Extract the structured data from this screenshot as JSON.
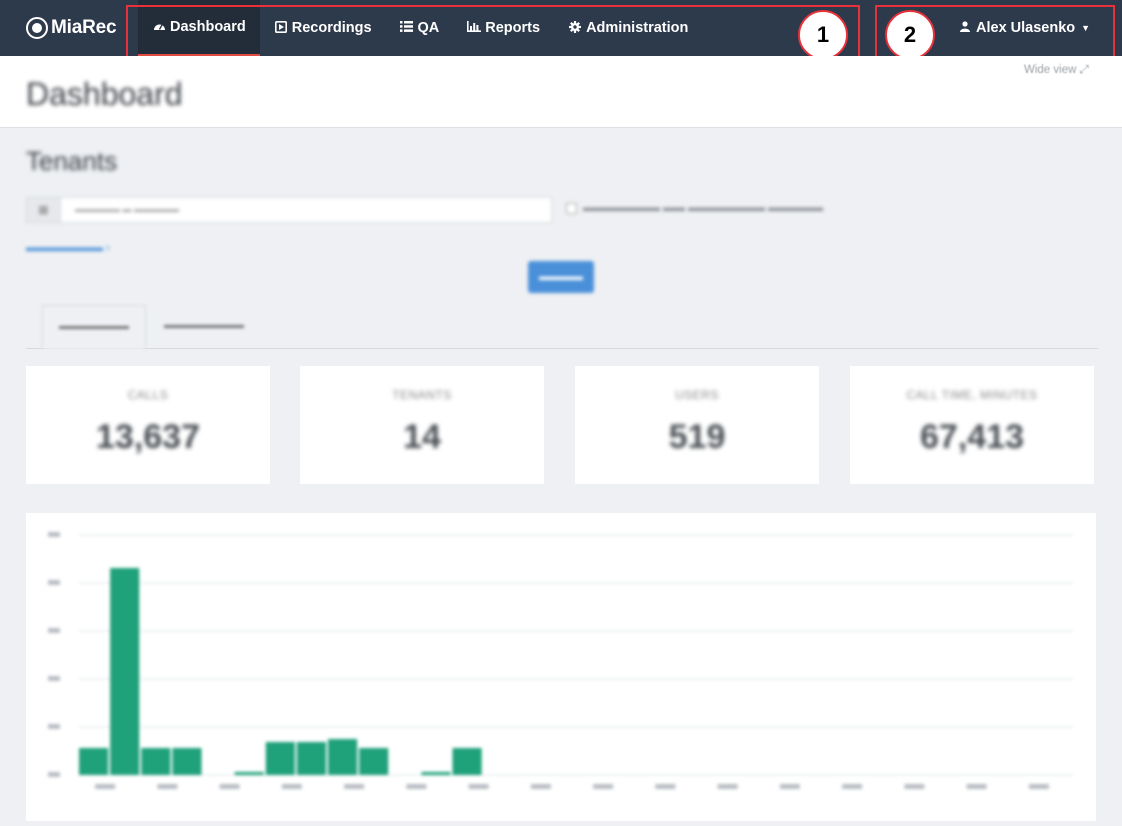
{
  "brand": {
    "name": "MiaRec"
  },
  "nav": {
    "items": [
      {
        "label": "Dashboard",
        "icon": "dashboard-icon",
        "active": true
      },
      {
        "label": "Recordings",
        "icon": "play-icon",
        "active": false
      },
      {
        "label": "QA",
        "icon": "list-icon",
        "active": false
      },
      {
        "label": "Reports",
        "icon": "bar-chart-icon",
        "active": false
      },
      {
        "label": "Administration",
        "icon": "gear-icon",
        "active": false
      }
    ],
    "user": {
      "name": "Alex Ulasenko",
      "icon": "user-icon"
    }
  },
  "annotations": [
    {
      "number": "1"
    },
    {
      "number": "2"
    }
  ],
  "page": {
    "title": "Dashboard",
    "wide_view": "Wide view"
  },
  "tenants": {
    "title": "Tenants",
    "stats": [
      {
        "label": "CALLS",
        "value": "13,637"
      },
      {
        "label": "TENANTS",
        "value": "14"
      },
      {
        "label": "USERS",
        "value": "519"
      },
      {
        "label": "CALL TIME, MINUTES",
        "value": "67,413"
      }
    ]
  },
  "colors": {
    "navbar": "#2d3a4b",
    "active_underline": "#e04b44",
    "annotation": "#e8313a",
    "bar": "#1fa17a",
    "button": "#4a90d9"
  },
  "chart_data": {
    "type": "bar",
    "values": [
      4.5,
      34.5,
      4.5,
      4.5,
      0,
      0.5,
      5.5,
      5.5,
      6,
      4.5,
      0,
      0.5,
      4.5,
      0,
      0,
      0,
      0,
      0,
      0,
      0,
      0,
      0,
      0,
      0,
      0,
      0,
      0,
      0,
      0,
      0,
      0,
      0
    ],
    "ylim": [
      0,
      40
    ],
    "grid": true
  }
}
